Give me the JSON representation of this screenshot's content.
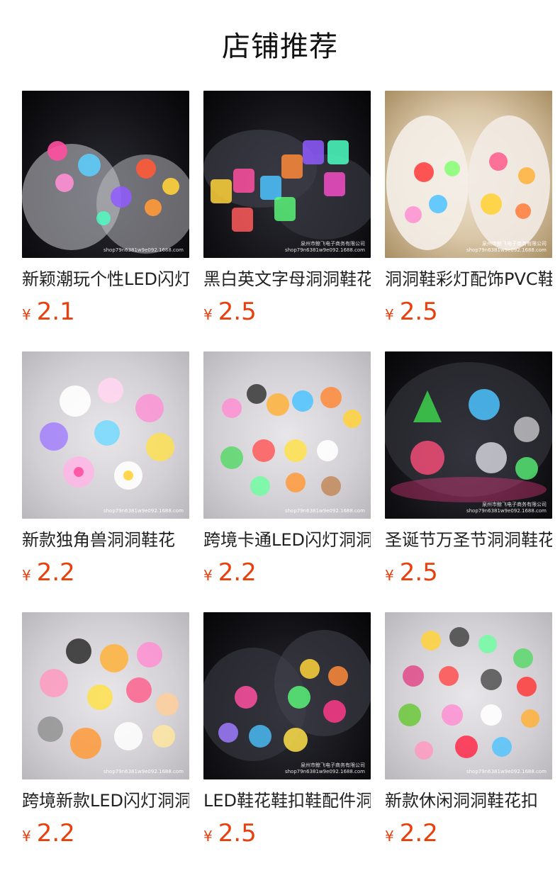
{
  "page": {
    "title": "店铺推荐"
  },
  "watermark": {
    "line1": "泉州市鲸飞电子商务有限公司",
    "line2": "shop79n6381w9e092.1688.com"
  },
  "colors": {
    "price": "#e8400c",
    "title": "#111111"
  },
  "products": [
    {
      "name": "新颖潮玩个性LED闪灯洞洞鞋花",
      "currency": "¥",
      "price": "2.1",
      "image": "glowing-clog-charms-dark"
    },
    {
      "name": "黑白英文字母洞洞鞋花",
      "currency": "¥",
      "price": "2.5",
      "image": "letter-charms-dark"
    },
    {
      "name": "洞洞鞋彩灯配饰PVC鞋花",
      "currency": "¥",
      "price": "2.5",
      "image": "christmas-clog-charms-warm"
    },
    {
      "name": "新款独角兽洞洞鞋花",
      "currency": "¥",
      "price": "2.2",
      "image": "unicorn-charms-light"
    },
    {
      "name": "跨境卡通LED闪灯洞洞鞋花",
      "currency": "¥",
      "price": "2.2",
      "image": "cartoon-animal-charms-light"
    },
    {
      "name": "圣诞节万圣节洞洞鞋花",
      "currency": "¥",
      "price": "2.5",
      "image": "christmas-charms-dark"
    },
    {
      "name": "跨境新款LED闪灯洞洞鞋花",
      "currency": "¥",
      "price": "2.2",
      "image": "animal-charms-light"
    },
    {
      "name": "LED鞋花鞋扣鞋配件洞洞鞋",
      "currency": "¥",
      "price": "2.5",
      "image": "glowing-flower-charms-dark"
    },
    {
      "name": "新款休闲洞洞鞋花扣",
      "currency": "¥",
      "price": "2.2",
      "image": "mixed-charms-light"
    }
  ]
}
